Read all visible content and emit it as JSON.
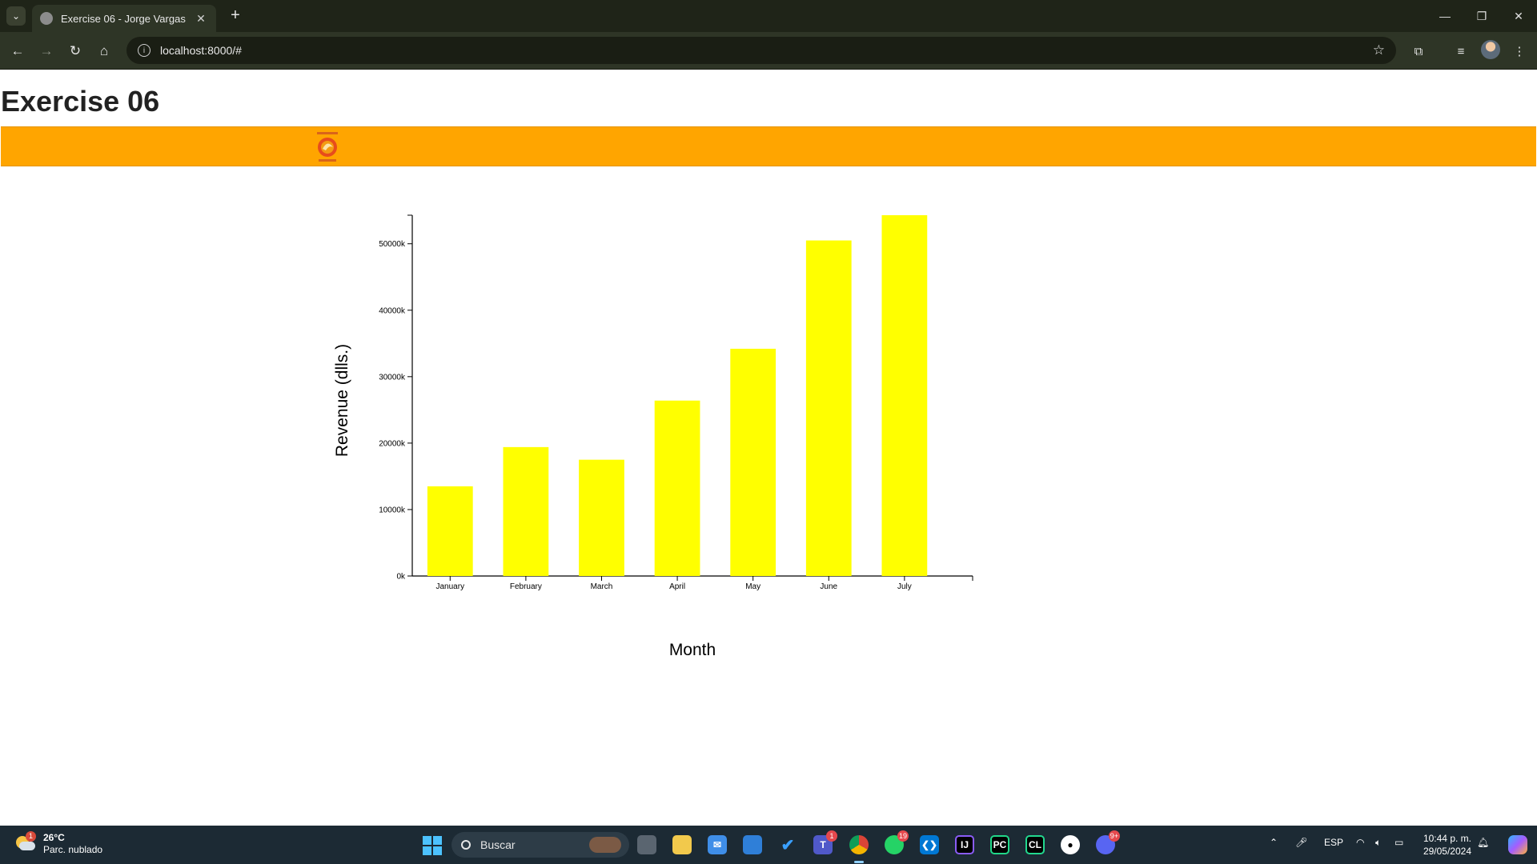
{
  "browser": {
    "tab_title": "Exercise 06 - Jorge Vargas",
    "url": "localhost:8000/#"
  },
  "page": {
    "title": "Exercise 06"
  },
  "chart_data": {
    "type": "bar",
    "categories": [
      "January",
      "February",
      "March",
      "April",
      "May",
      "June",
      "July"
    ],
    "values": [
      13500,
      19400,
      17500,
      26400,
      34200,
      50500,
      54300
    ],
    "xlabel": "Month",
    "ylabel": "Revenue (dlls.)",
    "ylim": [
      0,
      54300
    ],
    "yticks": [
      {
        "value": 0,
        "label": "0k"
      },
      {
        "value": 10000,
        "label": "10000k"
      },
      {
        "value": 20000,
        "label": "20000k"
      },
      {
        "value": 30000,
        "label": "30000k"
      },
      {
        "value": 40000,
        "label": "40000k"
      },
      {
        "value": 50000,
        "label": "50000k"
      }
    ],
    "bar_color": "#ffff00",
    "grid": false,
    "legend": "none"
  },
  "colors": {
    "banner": "#ffa500",
    "bar": "#ffff00"
  },
  "taskbar": {
    "weather_temp": "26°C",
    "weather_desc": "Parc. nublado",
    "weather_badge": "1",
    "search_placeholder": "Buscar",
    "teams_badge": "1",
    "whatsapp_badge": "19",
    "discord_badge": "9+",
    "language": "ESP",
    "time": "10:44 p. m.",
    "date": "29/05/2024"
  }
}
